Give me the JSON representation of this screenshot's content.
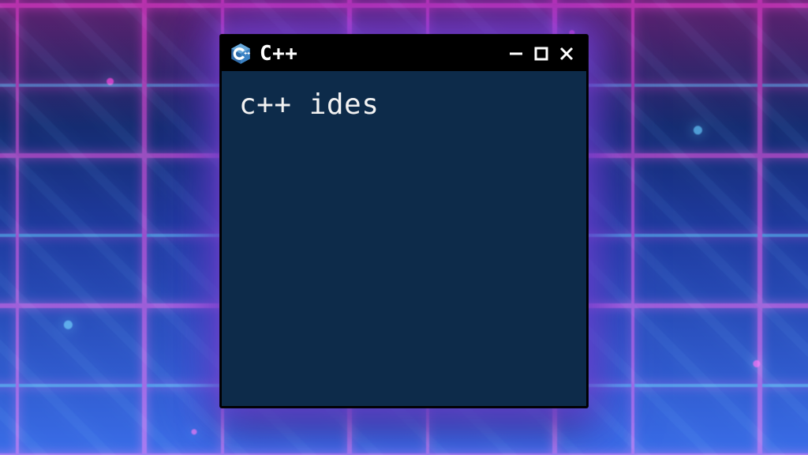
{
  "window": {
    "title": "C++",
    "icon": "cpp-logo-icon",
    "content_text": "c++ ides",
    "colors": {
      "titlebar_bg": "#000000",
      "content_bg": "#0d2b4a",
      "text": "#f2f2f2",
      "logo_primary": "#2f6aa8",
      "logo_accent": "#3b82c4"
    }
  }
}
